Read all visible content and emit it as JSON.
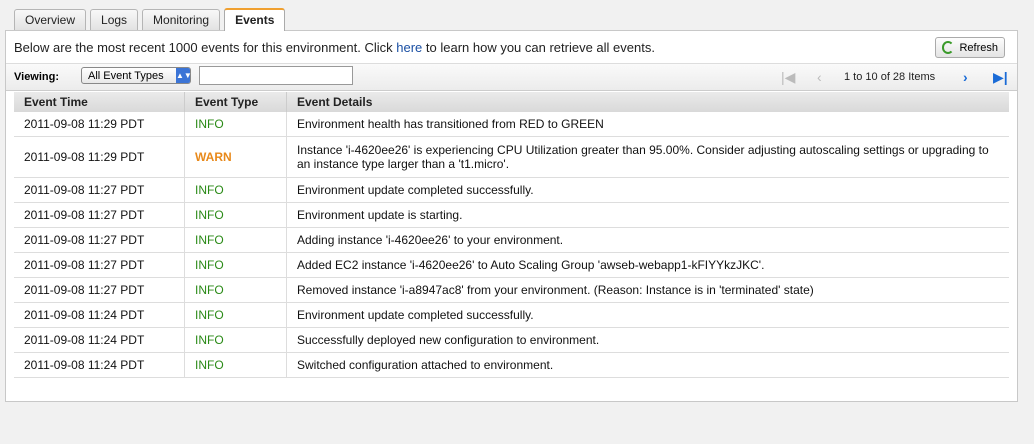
{
  "tabs": [
    {
      "label": "Overview",
      "active": false
    },
    {
      "label": "Logs",
      "active": false
    },
    {
      "label": "Monitoring",
      "active": false
    },
    {
      "label": "Events",
      "active": true
    }
  ],
  "intro": {
    "before": "Below are the most recent 1000 events for this environment. Click ",
    "link": "here",
    "after": " to learn how you can retrieve all events."
  },
  "refresh_label": "Refresh",
  "filter": {
    "label": "Viewing:",
    "selected": "All Event Types",
    "search_value": ""
  },
  "pager": {
    "text": "1 to 10 of 28 Items"
  },
  "table": {
    "headers": [
      "Event Time",
      "Event Type",
      "Event Details"
    ],
    "rows": [
      {
        "time": "2011-09-08 11:29 PDT",
        "type": "INFO",
        "details": "Environment health has transitioned from RED to GREEN"
      },
      {
        "time": "2011-09-08 11:29 PDT",
        "type": "WARN",
        "details": "Instance 'i-4620ee26' is experiencing CPU Utilization greater than 95.00%. Consider adjusting autoscaling settings or upgrading to an instance type larger than a 't1.micro'."
      },
      {
        "time": "2011-09-08 11:27 PDT",
        "type": "INFO",
        "details": "Environment update completed successfully."
      },
      {
        "time": "2011-09-08 11:27 PDT",
        "type": "INFO",
        "details": "Environment update is starting."
      },
      {
        "time": "2011-09-08 11:27 PDT",
        "type": "INFO",
        "details": "Adding instance 'i-4620ee26' to your environment."
      },
      {
        "time": "2011-09-08 11:27 PDT",
        "type": "INFO",
        "details": "Added EC2 instance 'i-4620ee26' to Auto Scaling Group 'awseb-webapp1-kFIYYkzJKC'."
      },
      {
        "time": "2011-09-08 11:27 PDT",
        "type": "INFO",
        "details": "Removed instance 'i-a8947ac8' from your environment. (Reason: Instance is in 'terminated' state)"
      },
      {
        "time": "2011-09-08 11:24 PDT",
        "type": "INFO",
        "details": "Environment update completed successfully."
      },
      {
        "time": "2011-09-08 11:24 PDT",
        "type": "INFO",
        "details": "Successfully deployed new configuration to environment."
      },
      {
        "time": "2011-09-08 11:24 PDT",
        "type": "INFO",
        "details": "Switched configuration attached to environment."
      }
    ]
  },
  "colors": {
    "info": "#2a8a16",
    "warn": "#e8891a",
    "link": "#1a4fa3",
    "active_tab_accent": "#f0a030"
  }
}
